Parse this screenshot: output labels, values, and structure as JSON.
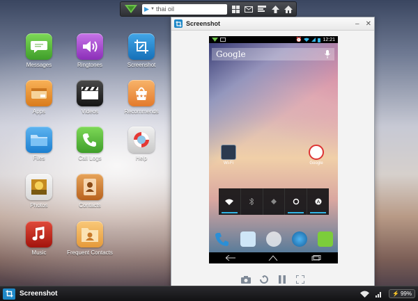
{
  "toolbar": {
    "search_value": "thai oil",
    "buttons": [
      "apps-grid-icon",
      "mail-icon",
      "screen-capture-icon",
      "upload-icon",
      "home-icon"
    ]
  },
  "desktop": {
    "apps": [
      {
        "label": "Messages",
        "icon": "messages-icon"
      },
      {
        "label": "Ringtones",
        "icon": "ringtones-icon"
      },
      {
        "label": "Screenshot",
        "icon": "screenshot-icon"
      },
      {
        "label": "Apps",
        "icon": "apps-icon"
      },
      {
        "label": "Videos",
        "icon": "videos-icon"
      },
      {
        "label": "Recommends",
        "icon": "recommends-icon"
      },
      {
        "label": "Files",
        "icon": "files-icon"
      },
      {
        "label": "Call Logs",
        "icon": "call-logs-icon"
      },
      {
        "label": "Help",
        "icon": "help-icon"
      },
      {
        "label": "Photos",
        "icon": "photos-icon"
      },
      {
        "label": "Contacts",
        "icon": "contacts-icon"
      },
      {
        "label": "Music",
        "icon": "music-icon"
      },
      {
        "label": "Frequent Contacts",
        "icon": "frequent-contacts-icon"
      }
    ]
  },
  "window": {
    "title": "Screenshot",
    "minimize": "–",
    "close": "✕"
  },
  "phone": {
    "time": "12:21",
    "search_text": "Google",
    "shortcut_wifi": "Wi-Fi",
    "shortcut_google": "Google"
  },
  "taskbar": {
    "task_label": "Screenshot",
    "battery": "99%"
  },
  "colors": {
    "accent": "#1e88c8",
    "android_blue": "#33b5e5"
  }
}
